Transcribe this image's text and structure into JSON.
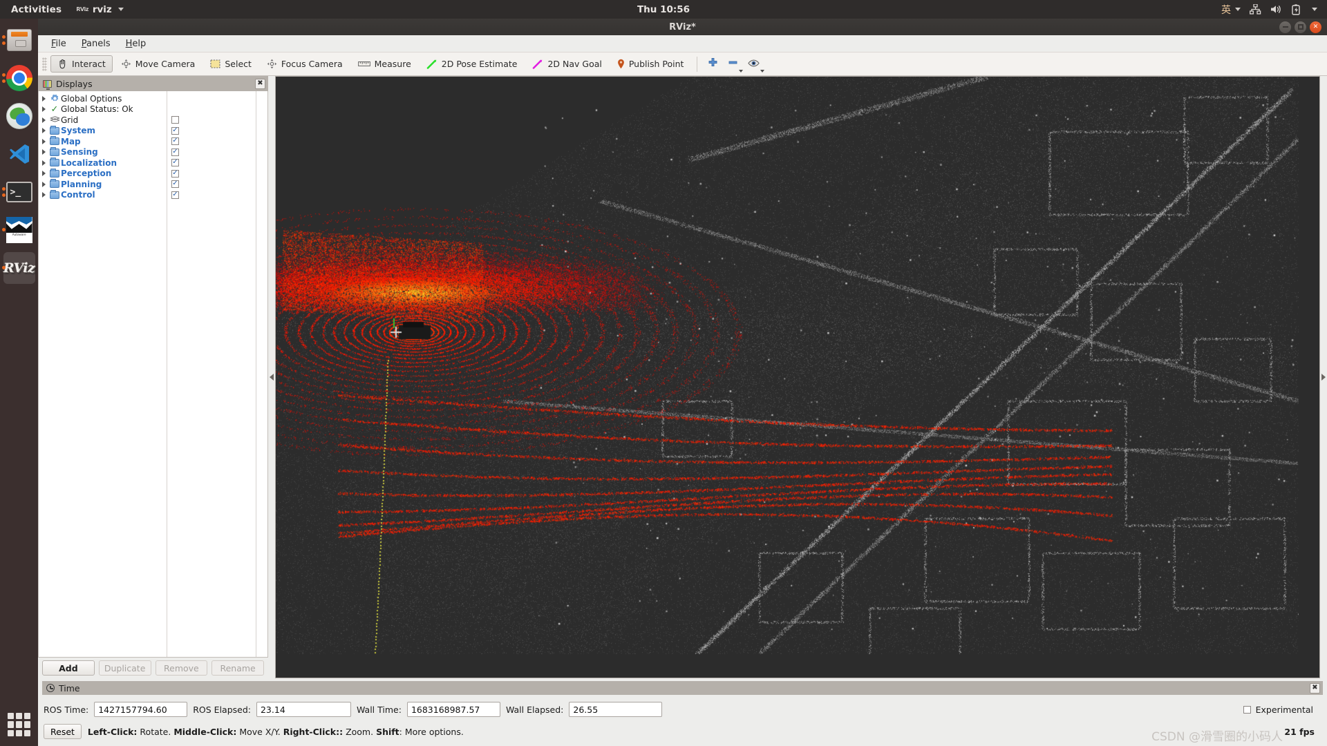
{
  "desktop": {
    "activities_label": "Activities",
    "app_indicator_icon": "rviz-app-icon",
    "app_name": "rviz",
    "clock": "Thu 10:56",
    "tray": {
      "ime_label": "英",
      "network_icon": "network-icon",
      "volume_icon": "volume-icon",
      "battery_icon": "battery-charging-icon",
      "menu_icon": "chevron-down-icon"
    },
    "dock": [
      {
        "name": "files",
        "label": "Files",
        "icon": "files-icon",
        "running": true,
        "active": false
      },
      {
        "name": "chrome",
        "label": "Google Chrome",
        "icon": "chrome-icon",
        "running": true,
        "active": false
      },
      {
        "name": "browser",
        "label": "Web Browser",
        "icon": "browser-icon",
        "running": false,
        "active": false
      },
      {
        "name": "vscode",
        "label": "Visual Studio Code",
        "icon": "vscode-icon",
        "running": false,
        "active": false
      },
      {
        "name": "terminal",
        "label": "Terminal",
        "icon": "terminal-icon",
        "running": true,
        "active": false
      },
      {
        "name": "autoware",
        "label": "Autoware",
        "icon": "autoware-icon",
        "running": true,
        "active": false
      },
      {
        "name": "rviz",
        "label": "RViz",
        "icon": "rviz-icon",
        "running": true,
        "active": true
      }
    ],
    "app_grid_icon": "app-grid-icon"
  },
  "window": {
    "title": "RViz*",
    "minimize_icon": "minimize-icon",
    "maximize_icon": "maximize-icon",
    "close_icon": "close-icon"
  },
  "menubar": [
    {
      "name": "file",
      "label": "File",
      "mnemonic": "F"
    },
    {
      "name": "panels",
      "label": "Panels",
      "mnemonic": "P"
    },
    {
      "name": "help",
      "label": "Help",
      "mnemonic": "H"
    }
  ],
  "toolbar": {
    "tools": [
      {
        "name": "interact",
        "label": "Interact",
        "icon": "hand-cursor-icon",
        "checked": true
      },
      {
        "name": "move-camera",
        "label": "Move Camera",
        "icon": "move-camera-icon",
        "checked": false
      },
      {
        "name": "select",
        "label": "Select",
        "icon": "select-rect-icon",
        "checked": false
      },
      {
        "name": "focus-camera",
        "label": "Focus Camera",
        "icon": "focus-camera-icon",
        "checked": false
      },
      {
        "name": "measure",
        "label": "Measure",
        "icon": "ruler-icon",
        "checked": false
      },
      {
        "name": "2d-pose-estimate",
        "label": "2D Pose Estimate",
        "icon": "green-arrow-icon",
        "checked": false
      },
      {
        "name": "2d-nav-goal",
        "label": "2D Nav Goal",
        "icon": "magenta-arrow-icon",
        "checked": false
      },
      {
        "name": "publish-point",
        "label": "Publish Point",
        "icon": "map-pin-icon",
        "checked": false
      }
    ],
    "icon_buttons": [
      {
        "name": "add-tool",
        "icon": "plus-icon",
        "has_arrow": false
      },
      {
        "name": "remove-tool",
        "icon": "minus-icon",
        "has_arrow": true
      },
      {
        "name": "tool-properties",
        "icon": "eye-icon",
        "has_arrow": true
      }
    ]
  },
  "displays": {
    "panel_title": "Displays",
    "panel_icon": "displays-icon",
    "close_icon": "close-icon",
    "tree": [
      {
        "name": "global-options",
        "label": "Global Options",
        "icon": "gear-icon",
        "kind": "options",
        "expandable": true,
        "checkbox": null
      },
      {
        "name": "global-status",
        "label": "Global Status: Ok",
        "icon": "check-icon",
        "kind": "status",
        "expandable": true,
        "checkbox": null
      },
      {
        "name": "grid",
        "label": "Grid",
        "icon": "grid-icon",
        "kind": "display",
        "expandable": true,
        "checkbox": false
      },
      {
        "name": "system",
        "label": "System",
        "icon": "folder-icon",
        "kind": "group",
        "expandable": true,
        "checkbox": true
      },
      {
        "name": "map",
        "label": "Map",
        "icon": "folder-icon",
        "kind": "group",
        "expandable": true,
        "checkbox": true
      },
      {
        "name": "sensing",
        "label": "Sensing",
        "icon": "folder-icon",
        "kind": "group",
        "expandable": true,
        "checkbox": true
      },
      {
        "name": "localization",
        "label": "Localization",
        "icon": "folder-icon",
        "kind": "group",
        "expandable": true,
        "checkbox": true
      },
      {
        "name": "perception",
        "label": "Perception",
        "icon": "folder-icon",
        "kind": "group",
        "expandable": true,
        "checkbox": true
      },
      {
        "name": "planning",
        "label": "Planning",
        "icon": "folder-icon",
        "kind": "group",
        "expandable": true,
        "checkbox": true
      },
      {
        "name": "control",
        "label": "Control",
        "icon": "folder-icon",
        "kind": "group",
        "expandable": true,
        "checkbox": true
      }
    ],
    "buttons": [
      {
        "name": "add",
        "label": "Add",
        "enabled": true
      },
      {
        "name": "duplicate",
        "label": "Duplicate",
        "enabled": false
      },
      {
        "name": "remove",
        "label": "Remove",
        "enabled": false
      },
      {
        "name": "rename",
        "label": "Rename",
        "enabled": false
      }
    ]
  },
  "time_panel": {
    "panel_title": "Time",
    "panel_icon": "clock-icon",
    "close_icon": "close-icon",
    "fields": [
      {
        "name": "ros-time",
        "label": "ROS Time:",
        "value": "1427157794.60"
      },
      {
        "name": "ros-elapsed",
        "label": "ROS Elapsed:",
        "value": "23.14"
      },
      {
        "name": "wall-time",
        "label": "Wall Time:",
        "value": "1683168987.57"
      },
      {
        "name": "wall-elapsed",
        "label": "Wall Elapsed:",
        "value": "26.55"
      }
    ],
    "experimental_label": "Experimental",
    "experimental_checked": false,
    "reset_label": "Reset",
    "hint": {
      "left_click_key": "Left-Click:",
      "left_click_action": "Rotate.",
      "middle_click_key": "Middle-Click:",
      "middle_click_action": "Move X/Y.",
      "right_click_key": "Right-Click::",
      "right_click_action": "Zoom.",
      "shift_key": "Shift",
      "shift_action": ": More options."
    },
    "fps": "21 fps"
  },
  "viewport": {
    "name": "3d-render-view",
    "background_color": "#2c2c2c",
    "map_point_color": "#9a9a9a",
    "lidar_near_color": "#ff2200",
    "lidar_hot_color": "#ffd000",
    "trajectory_color": "#c8c83c",
    "ego_vehicle_color": "#1a1a1a",
    "left_handle_icon": "collapse-left-icon",
    "right_handle_icon": "collapse-right-icon"
  },
  "watermark": "CSDN @滑雪圈的小码人"
}
